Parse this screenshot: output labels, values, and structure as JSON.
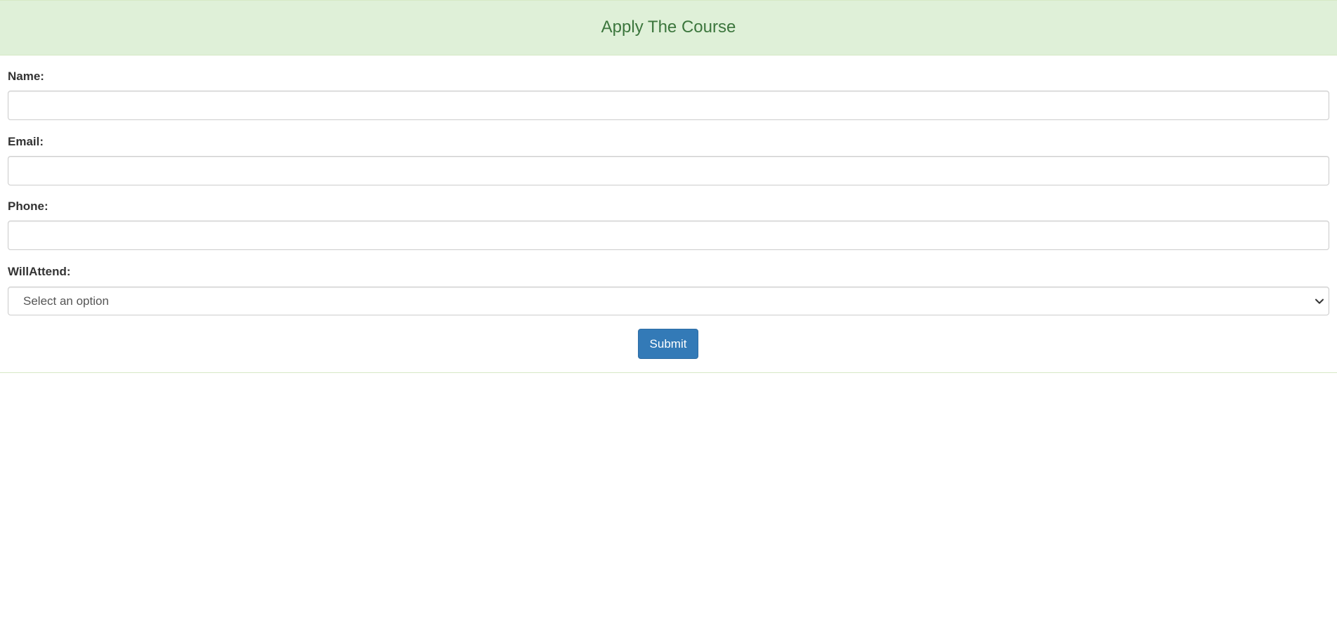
{
  "header": {
    "title": "Apply The Course"
  },
  "form": {
    "name_label": "Name:",
    "name_value": "",
    "email_label": "Email:",
    "email_value": "",
    "phone_label": "Phone:",
    "phone_value": "",
    "attend_label": "WillAttend:",
    "attend_selected": "Select an option",
    "submit_label": "Submit"
  },
  "icons": {
    "select_arrow": "chevron-down-icon"
  },
  "colors": {
    "header_bg": "#dff0d8",
    "header_text": "#3c763d",
    "button_bg": "#337ab7",
    "button_text": "#ffffff"
  }
}
